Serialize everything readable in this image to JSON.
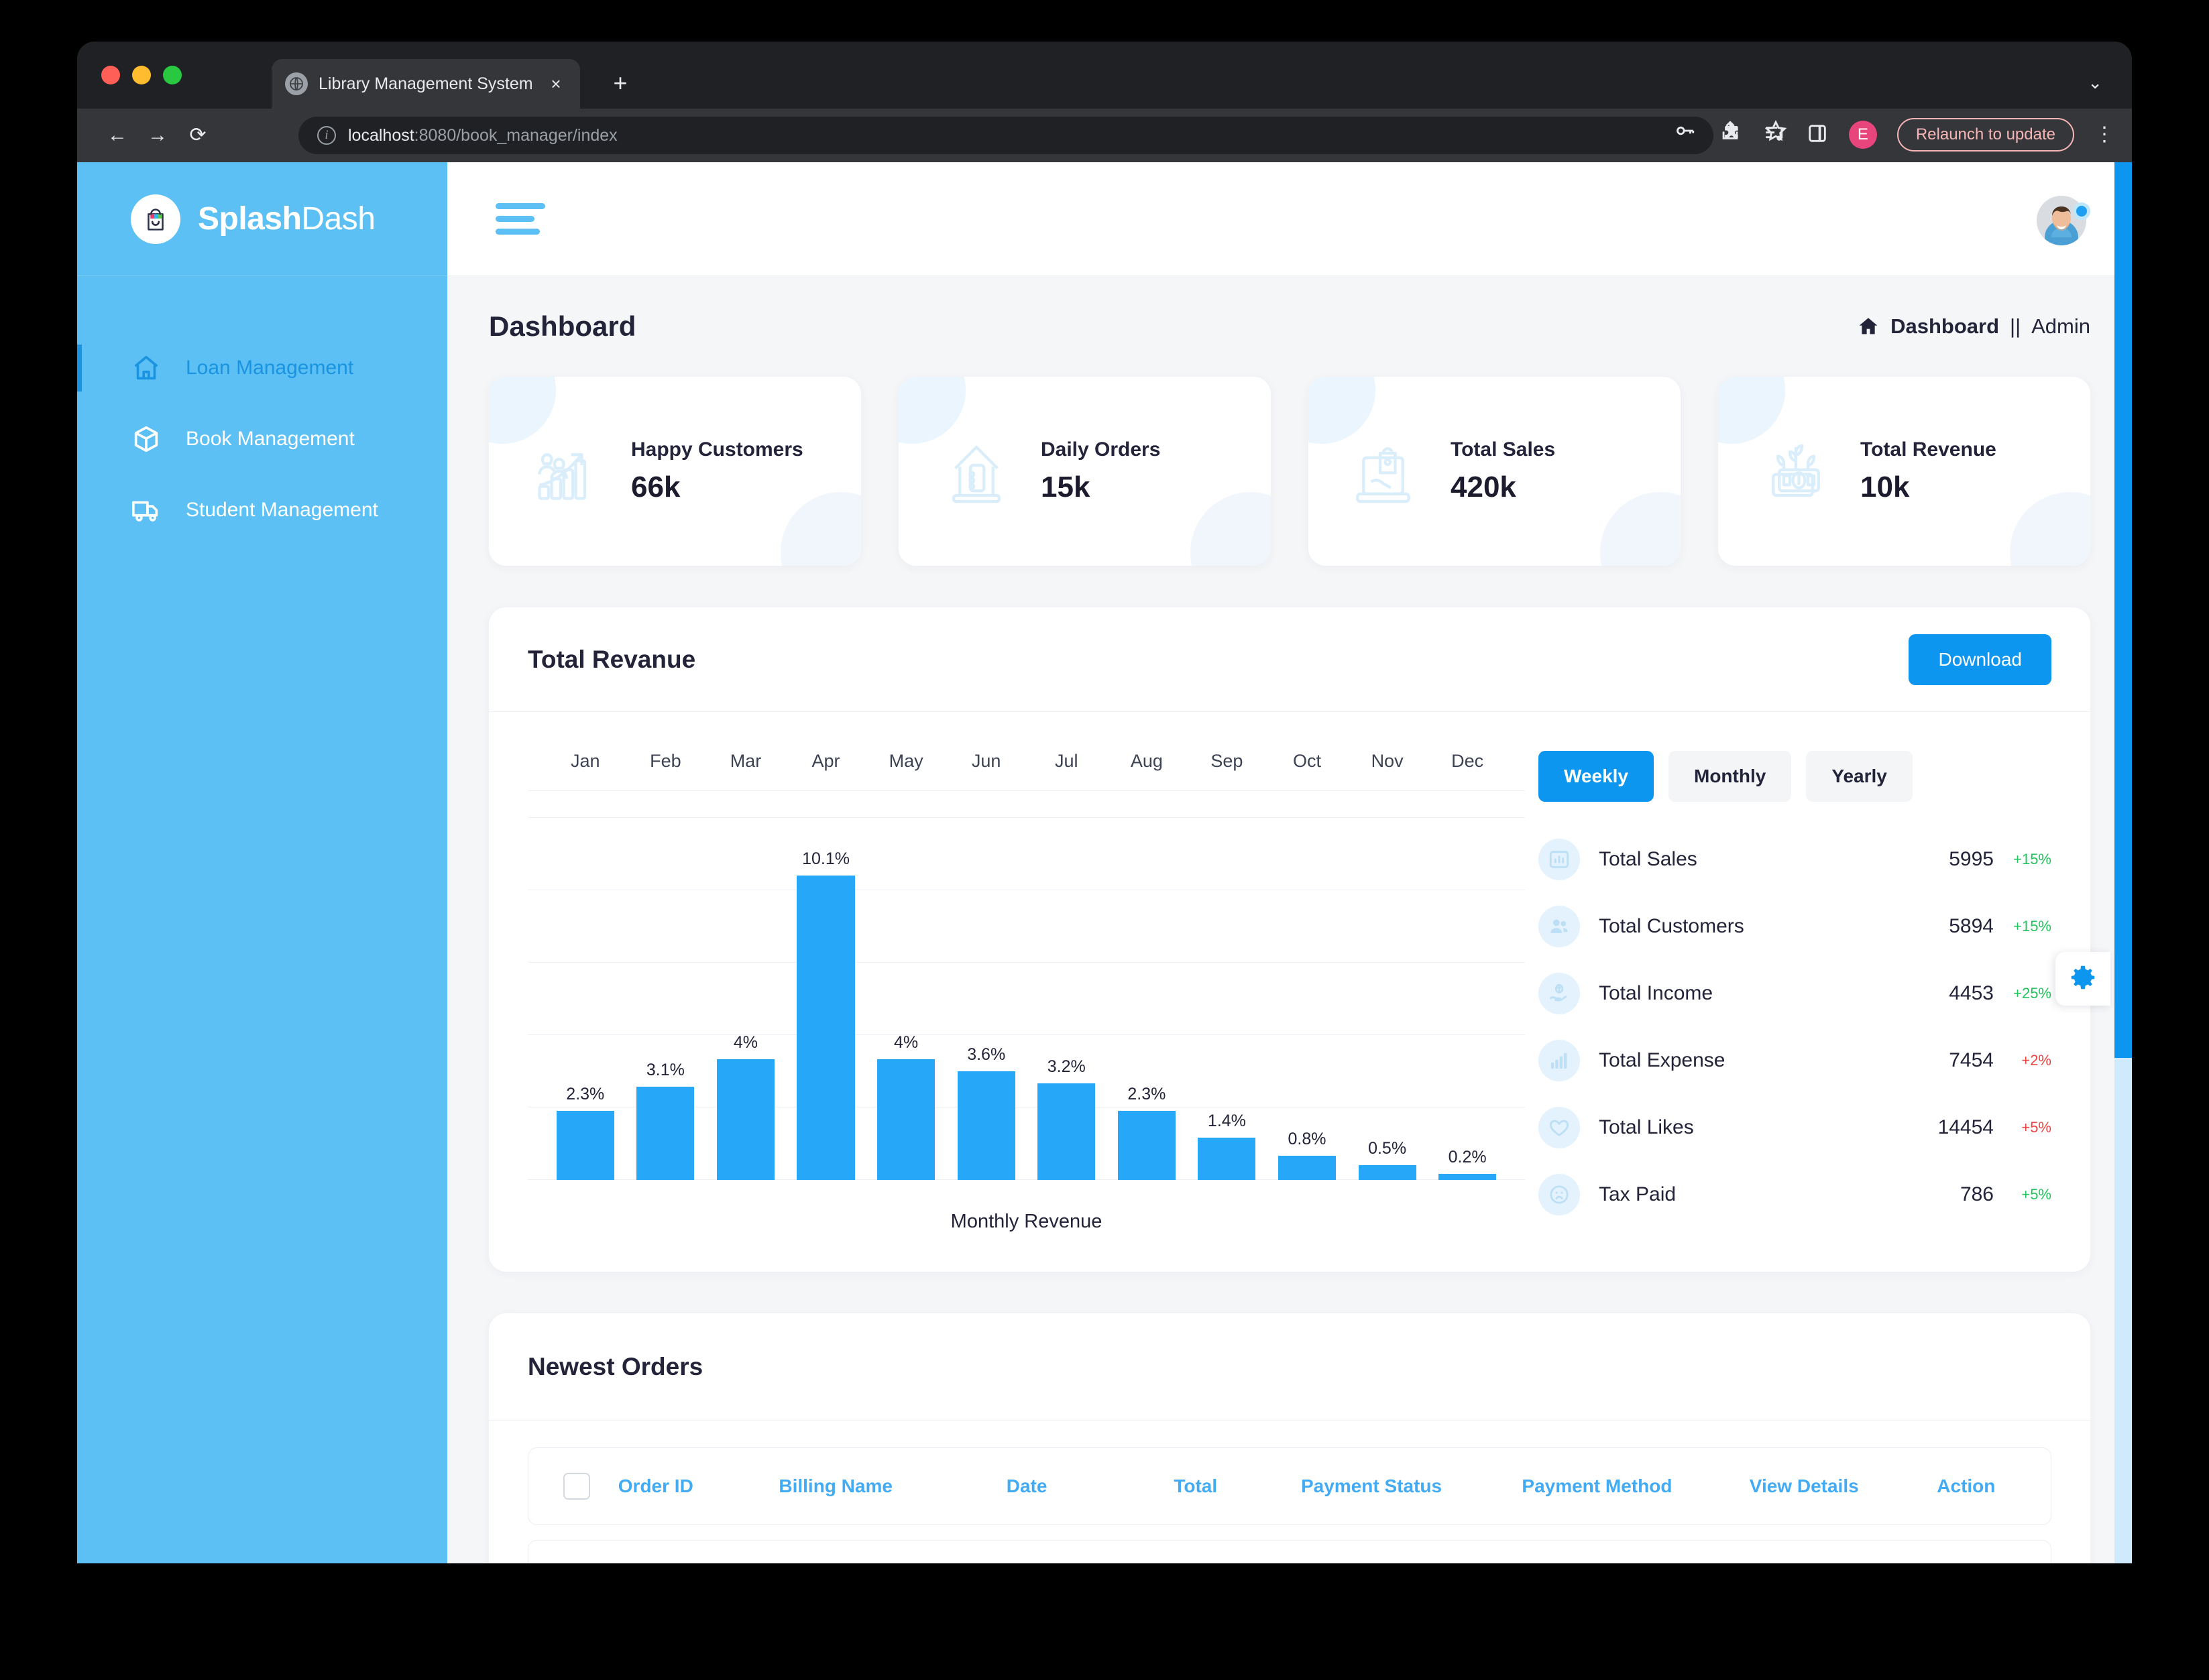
{
  "browser": {
    "tab": {
      "title": "Library Management System",
      "favicon": "globe-icon",
      "close": "×"
    },
    "new_tab": "+",
    "tab_list_chevron": "⌄",
    "nav": {
      "back": "←",
      "forward": "→",
      "reload": "⟳"
    },
    "omnibox": {
      "info_icon": "i",
      "url_host": "localhost",
      "url_path": ":8080/book_manager/index"
    },
    "actions": [
      "key-icon",
      "share-icon",
      "star-icon"
    ],
    "toolbar": [
      "extensions-icon",
      "media-control-icon",
      "side-panel-icon"
    ],
    "profile_initial": "E",
    "relaunch_label": "Relaunch to update",
    "menu": "⋮"
  },
  "sidebar": {
    "brand_bold": "Splash",
    "brand_light": "Dash",
    "items": [
      {
        "label": "Loan Management",
        "icon": "home-icon",
        "active": true
      },
      {
        "label": "Book Management",
        "icon": "box-icon",
        "active": false
      },
      {
        "label": "Student Management",
        "icon": "truck-icon",
        "active": false
      }
    ]
  },
  "header": {
    "menu_toggle": "hamburger-icon",
    "avatar": "user-avatar",
    "status": "online"
  },
  "page": {
    "title": "Dashboard",
    "breadcrumb": {
      "home_icon": "home-icon",
      "current": "Dashboard",
      "separator": "||",
      "parent": "Admin"
    }
  },
  "stat_cards": [
    {
      "label": "Happy Customers",
      "value": "66k",
      "icon": "growth-chart-people-icon"
    },
    {
      "label": "Daily Orders",
      "value": "15k",
      "icon": "store-house-icon"
    },
    {
      "label": "Total Sales",
      "value": "420k",
      "icon": "laptop-shopping-icon"
    },
    {
      "label": "Total Revenue",
      "value": "10k",
      "icon": "money-plant-icon"
    }
  ],
  "revenue_panel": {
    "title": "Total Revanue",
    "download_label": "Download",
    "range_tabs": [
      {
        "label": "Weekly",
        "active": true
      },
      {
        "label": "Monthly",
        "active": false
      },
      {
        "label": "Yearly",
        "active": false
      }
    ],
    "stats": [
      {
        "icon": "bar-chart-icon",
        "name": "Total Sales",
        "value": "5995",
        "delta": "+15%",
        "dir": "up"
      },
      {
        "icon": "users-icon",
        "name": "Total Customers",
        "value": "5894",
        "delta": "+15%",
        "dir": "up"
      },
      {
        "icon": "hand-money-icon",
        "name": "Total Income",
        "value": "4453",
        "delta": "+25%",
        "dir": "up"
      },
      {
        "icon": "bars-up-icon",
        "name": "Total Expense",
        "value": "7454",
        "delta": "+2%",
        "dir": "down"
      },
      {
        "icon": "heart-icon",
        "name": "Total Likes",
        "value": "14454",
        "delta": "+5%",
        "dir": "down"
      },
      {
        "icon": "sad-face-icon",
        "name": "Tax Paid",
        "value": "786",
        "delta": "+5%",
        "dir": "up"
      }
    ]
  },
  "chart_data": {
    "type": "bar",
    "title": "Total Revanue",
    "xlabel": "Monthly Revenue",
    "ylabel": "",
    "categories": [
      "Jan",
      "Feb",
      "Mar",
      "Apr",
      "May",
      "Jun",
      "Jul",
      "Aug",
      "Sep",
      "Oct",
      "Nov",
      "Dec"
    ],
    "values": [
      2.3,
      3.1,
      4,
      10.1,
      4,
      3.6,
      3.2,
      2.3,
      1.4,
      0.8,
      0.5,
      0.2
    ],
    "data_labels": [
      "2.3%",
      "3.1%",
      "4%",
      "10.1%",
      "4%",
      "3.6%",
      "3.2%",
      "2.3%",
      "1.4%",
      "0.8%",
      "0.5%",
      "0.2%"
    ],
    "unit": "%",
    "ylim": [
      0,
      12
    ],
    "gridlines": [
      0,
      2.4,
      4.8,
      7.2,
      9.6,
      12
    ],
    "grid": true,
    "legend": "none",
    "bar_color": "#26a7f7",
    "category_axis_position": "top"
  },
  "orders_panel": {
    "title": "Newest Orders",
    "columns": [
      "Order ID",
      "Billing Name",
      "Date",
      "Total",
      "Payment Status",
      "Payment Method",
      "View Details",
      "Action"
    ]
  },
  "floating": {
    "settings_icon": "gear-icon"
  },
  "colors": {
    "accent": "#0d96ef",
    "sidebar": "#5cc0f5",
    "bar": "#26a7f7",
    "positive": "#22c55e",
    "negative": "#ef4444",
    "header_blue": "#43abf4"
  }
}
